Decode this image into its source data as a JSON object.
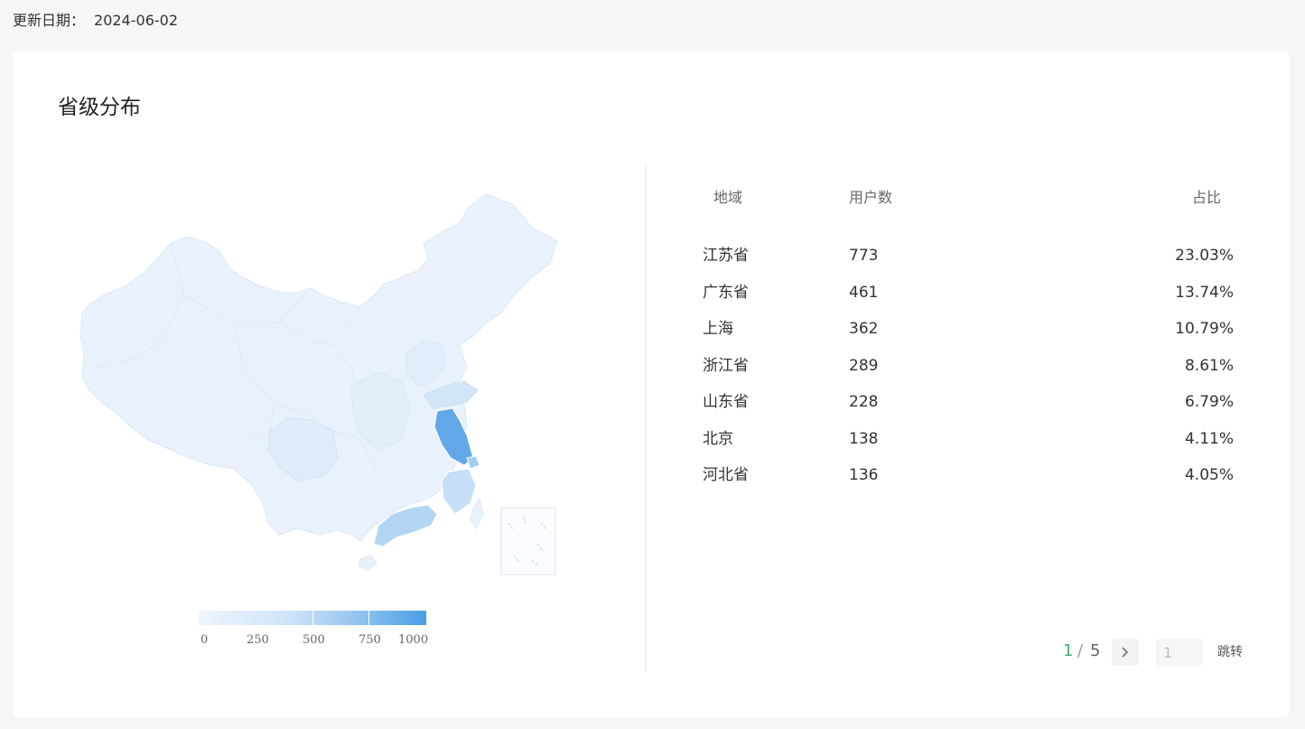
{
  "header": {
    "update_label": "更新日期：",
    "update_date": "2024-06-02"
  },
  "card": {
    "title": "省级分布"
  },
  "legend": {
    "ticks": [
      "0",
      "250",
      "500",
      "750",
      "1000"
    ],
    "min": 0,
    "max": 1000,
    "colors": [
      "#eef5fd",
      "#cfe4f9",
      "#93c4f0",
      "#4a9ee6"
    ]
  },
  "table": {
    "headers": {
      "region": "地域",
      "users": "用户数",
      "pct": "占比"
    },
    "rows": [
      {
        "region": "江苏省",
        "users": "773",
        "pct": "23.03%"
      },
      {
        "region": "广东省",
        "users": "461",
        "pct": "13.74%"
      },
      {
        "region": "上海",
        "users": "362",
        "pct": "10.79%"
      },
      {
        "region": "浙江省",
        "users": "289",
        "pct": "8.61%"
      },
      {
        "region": "山东省",
        "users": "228",
        "pct": "6.79%"
      },
      {
        "region": "北京",
        "users": "138",
        "pct": "4.11%"
      },
      {
        "region": "河北省",
        "users": "136",
        "pct": "4.05%"
      }
    ]
  },
  "pager": {
    "current": "1",
    "separator": "/",
    "total": "5",
    "jump_placeholder": "1",
    "jump_label": "跳转",
    "next_icon": "chevron-right-icon"
  }
}
